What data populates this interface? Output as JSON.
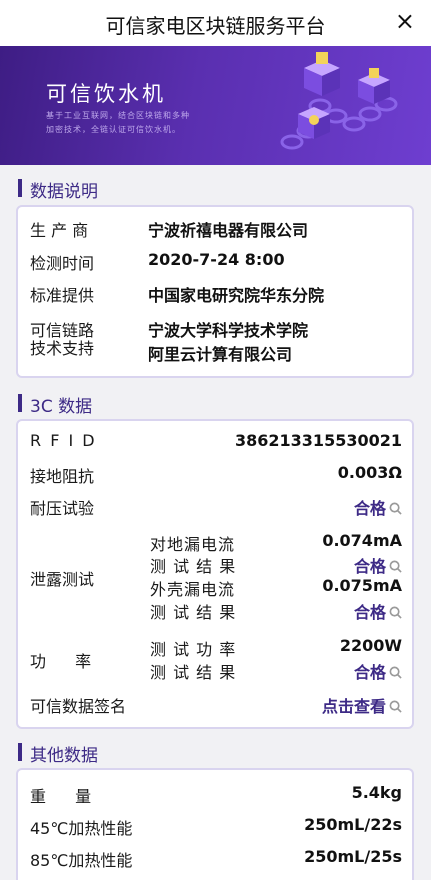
{
  "header": {
    "title": "可信家电区块链服务平台",
    "close_icon": "×"
  },
  "banner": {
    "title": "可信饮水机",
    "description": "基于工业互联网，结合区块链和多种加密技术，全链认证可信饮水机。"
  },
  "sections": {
    "data_description": "数据说明",
    "cc_data": "3C 数据",
    "other_data": "其他数据"
  },
  "info": {
    "manufacturer_label": "生 产 商",
    "manufacturer": "宁波祈禧电器有限公司",
    "test_time_label": "检测时间",
    "test_time": "2020-7-24 8:00",
    "standard_label": "标准提供",
    "standard": "中国家电研究院华东分院",
    "support_label_1": "可信链路",
    "support_label_2": "技术支持",
    "support_1": "宁波大学科学技术学院",
    "support_2": "阿里云计算有限公司"
  },
  "cc": {
    "rfid_label": "R F I D",
    "rfid": "386213315530021",
    "ground_label": "接地阻抗",
    "ground": "0.003Ω",
    "voltage_label": "耐压试验",
    "pass": "合格",
    "leak_label": "泄露测试",
    "leak_ground_label": "对地漏电流",
    "leak_ground": "0.074mA",
    "result_label": "测 试 结 果",
    "leak_shell_label": "外壳漏电流",
    "leak_shell": "0.075mA",
    "power_label": "功 率",
    "power_test_label": "测 试 功 率",
    "power": "2200W",
    "sign_label": "可信数据签名",
    "sign_link": "点击查看"
  },
  "other": {
    "weight_label": "重 量",
    "weight": "5.4kg",
    "heat45_label": "45℃加热性能",
    "heat45": "250mL/22s",
    "heat85_label": "85℃加热性能",
    "heat85": "250mL/25s"
  },
  "colors": {
    "accent": "#3d2a86",
    "banner": "#5a2fb0",
    "card_border": "#d9d4ef"
  }
}
